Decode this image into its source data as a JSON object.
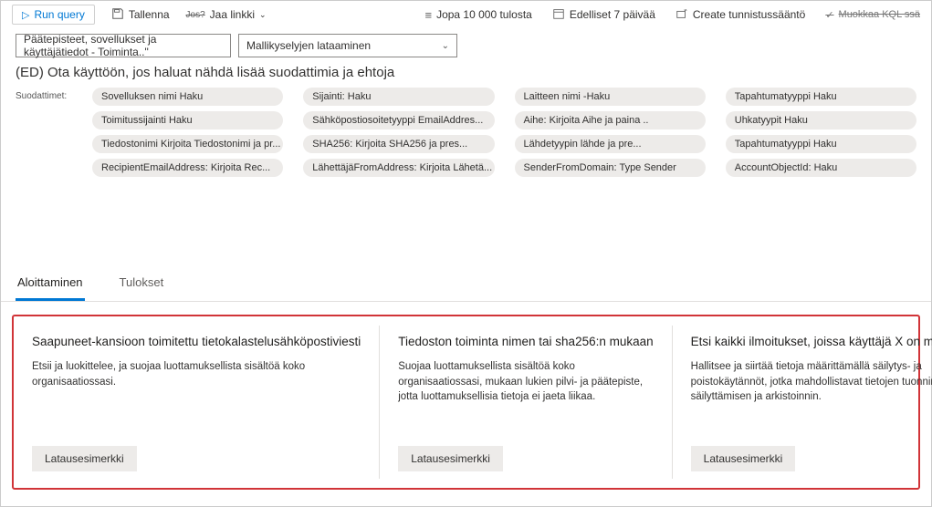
{
  "toolbar": {
    "run_query": "Run query",
    "save": "Tallenna",
    "share_q": "Jos?",
    "share": "Jaa linkki",
    "results": "Jopa 10 000 tulosta",
    "time": "Edelliset 7 päivää",
    "create_rule": "Create tunnistussääntö",
    "edit_kql": "Muokkaa KQL ssä"
  },
  "selectors": {
    "first": "Päätepisteet, sovellukset ja käyttäjätiedot - Toiminta..\"",
    "second": "Mallikyselyjen lataaminen"
  },
  "subtitle": "(ED) Ota käyttöön, jos haluat nähdä lisää suodattimia ja ehtoja",
  "filters_label": "Suodattimet:",
  "filters": [
    [
      "Sovelluksen nimi Haku",
      "Sijainti: Haku",
      "Laitteen nimi -Haku",
      "Tapahtumatyyppi Haku"
    ],
    [
      "Toimitussijainti Haku",
      "Sähköpostiosoitetyyppi EmailAddres...",
      "Aihe: Kirjoita Aihe ja paina ..",
      "Uhkatyypit Haku"
    ],
    [
      "Tiedostonimi Kirjoita Tiedostonimi ja pr...",
      "SHA256: Kirjoita SHA256 ja pres...",
      "Lähdetyypin lähde ja pre...",
      "Tapahtumatyyppi Haku"
    ],
    [
      "RecipientEmailAddress: Kirjoita Rec...",
      "LähettäjäFromAddress: Kirjoita Lähetä...",
      "SenderFromDomain: Type Sender",
      "AccountObjectId: Haku"
    ]
  ],
  "tabs": {
    "getting_started": "Aloittaminen",
    "results": "Tulokset"
  },
  "cards": [
    {
      "title": "Saapuneet-kansioon toimitettu tietokalastelusähköpostiviesti",
      "desc": "Etsii ja luokittelee, ja suojaa luottamuksellista sisältöä koko organisaatiossasi.",
      "btn": "Latausesimerkki"
    },
    {
      "title": "Tiedoston toiminta nimen tai sha256:n mukaan",
      "desc": "Suojaa luottamuksellista sisältöä koko organisaatiossasi, mukaan lukien pilvi- ja päätepiste, jotta luottamuksellisia tietoja ei jaeta liikaa.",
      "btn": "Latausesimerkki"
    },
    {
      "title": "Etsi kaikki ilmoitukset, joissa käyttäjä X on mukana",
      "desc": "Hallitsee ja siirtää tietoja määrittämällä säilytys- ja poistokäytännöt, jotka mahdollistavat tietojen tuonnin, säilyttämisen ja arkistoinnin.",
      "btn": "Latausesimerkki"
    }
  ]
}
